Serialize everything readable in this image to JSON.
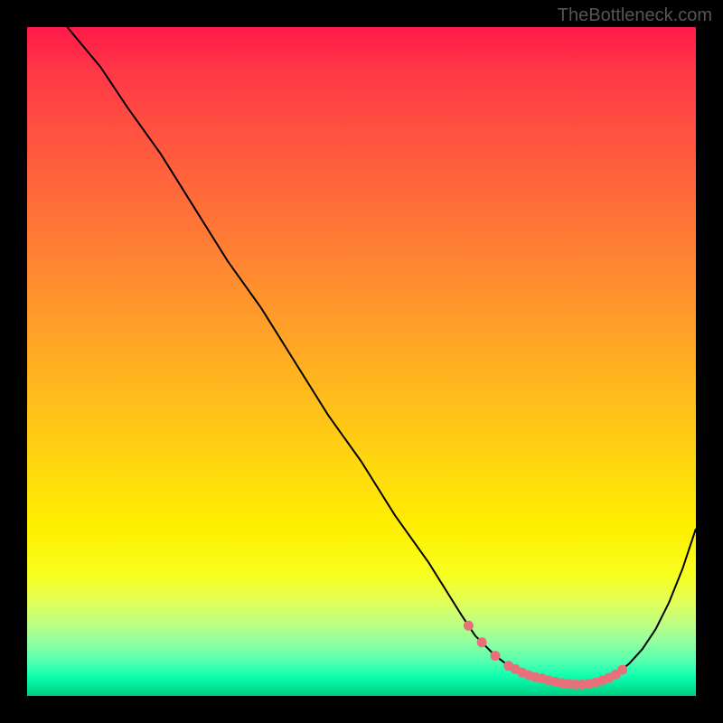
{
  "watermark": "TheBottleneck.com",
  "chart_data": {
    "type": "line",
    "title": "",
    "xlabel": "",
    "ylabel": "",
    "xlim": [
      0,
      100
    ],
    "ylim": [
      0,
      100
    ],
    "series": [
      {
        "name": "curve",
        "x": [
          6,
          11,
          15,
          20,
          25,
          30,
          35,
          40,
          45,
          50,
          55,
          60,
          65,
          67,
          70,
          72,
          74,
          76,
          78,
          80,
          82,
          84,
          86,
          88,
          90,
          92,
          94,
          96,
          98,
          100
        ],
        "y": [
          100,
          94,
          88,
          81,
          73,
          65,
          58,
          50,
          42,
          35,
          27,
          20,
          12,
          9,
          6,
          4.5,
          3.5,
          2.8,
          2.3,
          1.9,
          1.7,
          1.8,
          2.3,
          3.2,
          4.8,
          7.0,
          10.0,
          14.0,
          19.0,
          25.0
        ]
      }
    ],
    "annotations": {
      "valley_dots": {
        "x": [
          66,
          68,
          70,
          72,
          73,
          74,
          75,
          76,
          77,
          78,
          79,
          80,
          81,
          82,
          83,
          84,
          85,
          86,
          87,
          88,
          89
        ],
        "y": [
          10.5,
          8.0,
          6.0,
          4.5,
          4.0,
          3.5,
          3.1,
          2.8,
          2.6,
          2.3,
          2.1,
          1.9,
          1.8,
          1.7,
          1.7,
          1.8,
          2.0,
          2.3,
          2.7,
          3.2,
          3.9
        ]
      }
    }
  }
}
